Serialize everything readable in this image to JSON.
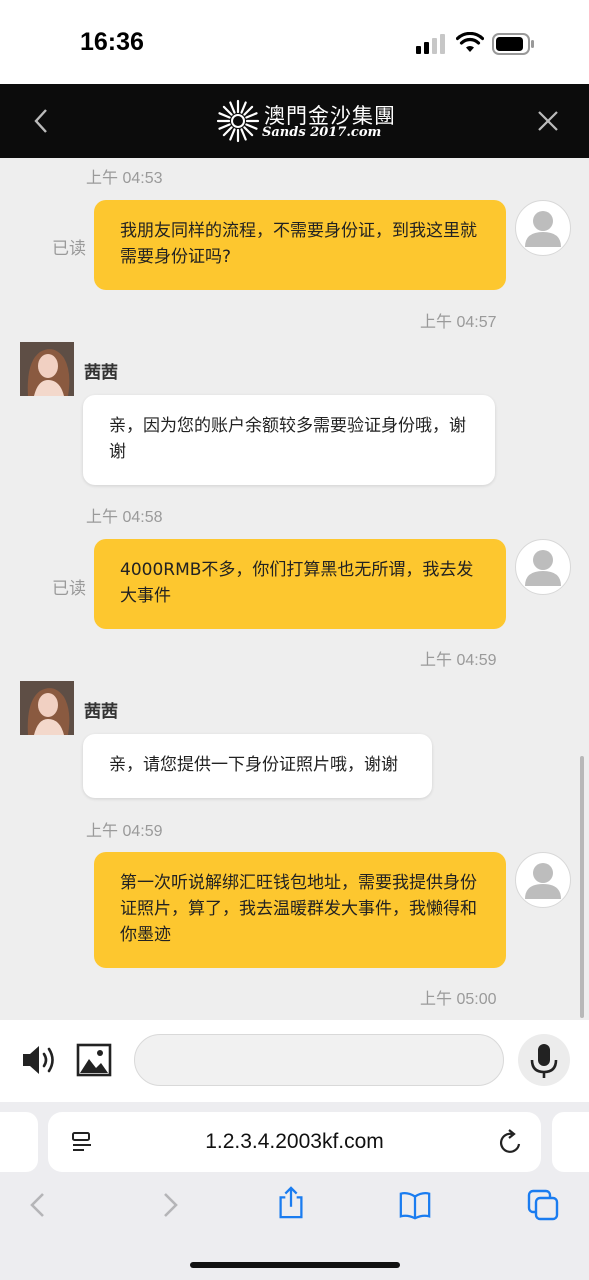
{
  "status_bar": {
    "time": "16:36"
  },
  "header": {
    "logo_cn": "澳門金沙集團",
    "logo_en": "Sands 2017.com",
    "back_icon": "chevron-left-icon",
    "close_icon": "close-icon"
  },
  "messages": [
    {
      "sender": "me",
      "time": "上午 04:53",
      "text": "我朋友同样的流程，不需要身份证，到我这里就需要身份证吗?",
      "read": "已读"
    },
    {
      "sender": "agent",
      "time": "上午 04:57",
      "name": "茜茜",
      "text": "亲，因为您的账户余额较多需要验证身份哦，谢谢"
    },
    {
      "sender": "me",
      "time": "上午 04:58",
      "text": "4000RMB不多，你们打算黑也无所谓，我去发大事件",
      "read": "已读"
    },
    {
      "sender": "agent",
      "time": "上午 04:59",
      "name": "茜茜",
      "text": "亲，请您提供一下身份证照片哦，谢谢"
    },
    {
      "sender": "me",
      "time": "上午 04:59",
      "text": "第一次听说解绑汇旺钱包地址，需要我提供身份证照片，算了，我去温暖群发大事件，我懒得和你墨迹"
    }
  ],
  "last_time": "上午 05:00",
  "input": {
    "placeholder": ""
  },
  "browser": {
    "url": "1.2.3.4.2003kf.com"
  },
  "colors": {
    "my_bubble": "#fdc72f",
    "header_bg": "#0c0c0c",
    "chat_bg": "#eeeeee",
    "browser_accent": "#1a7cf0"
  }
}
